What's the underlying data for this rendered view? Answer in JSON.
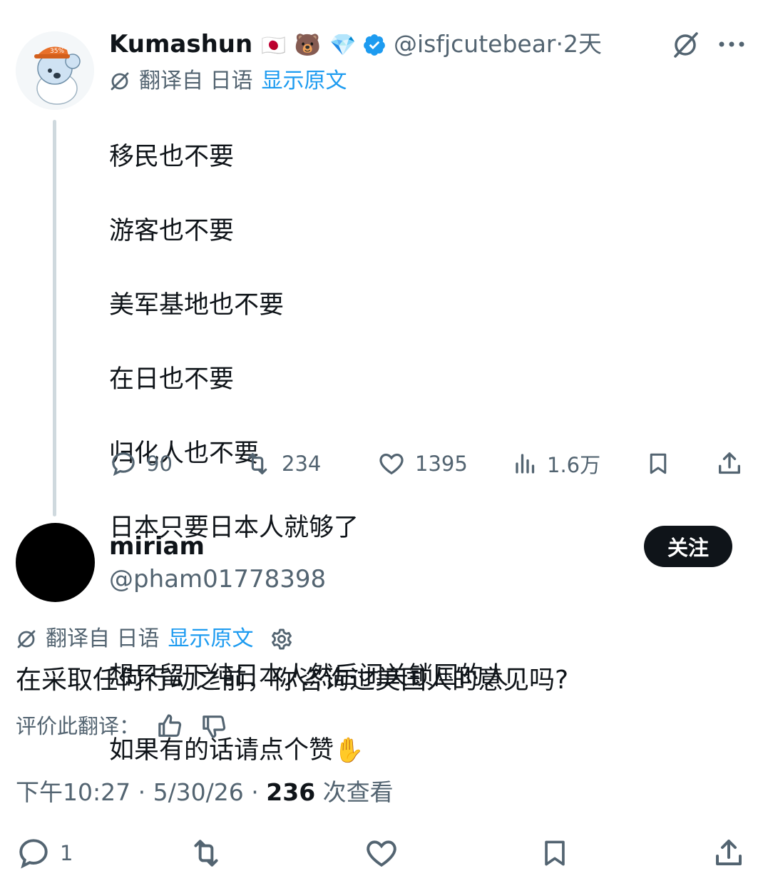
{
  "tweet": {
    "author_name": "Kumashun",
    "author_emojis": [
      "🇯🇵",
      "🐻",
      "💎"
    ],
    "handle": "@isfjcutebear",
    "time": "2天",
    "translate_label": "翻译自 日语",
    "show_original": "显示原文",
    "lines": [
      "移民也不要",
      "游客也不要",
      "美军基地也不要",
      "在日也不要",
      "归化人也不要",
      "日本只要日本人就够了",
      "",
      "想只留下纯日本人然后闭关锁国的人",
      "如果有的话请点个赞"
    ],
    "replies": "90",
    "retweets": "234",
    "likes": "1395",
    "views": "1.6万"
  },
  "reply": {
    "author_name": "miriam",
    "handle": "@pham01778398",
    "follow_label": "关注",
    "translate_label": "翻译自 日语",
    "show_original": "显示原文",
    "text": "在采取任何行动之前，你咨询过美国人的意见吗?",
    "rate_label": "评价此翻译：",
    "time": "下午10:27 · 5/30/26 · ",
    "views_count": "236",
    "views_label": " 次查看",
    "replies": "1"
  },
  "colors": {
    "accent": "#1d9bf0",
    "verified": "#1d9bf0",
    "text": "#0f1419",
    "secondary": "#536471"
  }
}
